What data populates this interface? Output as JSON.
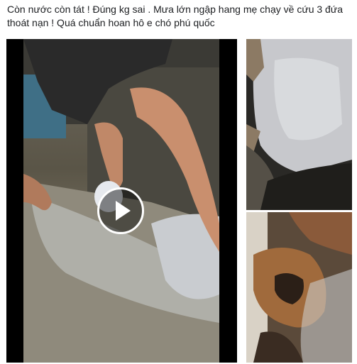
{
  "post": {
    "text": "Còn nước còn tát ! Đúng kg sai . Mưa lớn ngập hang mẹ chạy về cứu 3 đứa thoát nạn ! Quá chuẩn hoan hô e chó phú quốc"
  },
  "media": {
    "video": {
      "play_icon": "play-icon"
    },
    "photos": [
      "puddle-photo",
      "puppies-photo"
    ]
  }
}
